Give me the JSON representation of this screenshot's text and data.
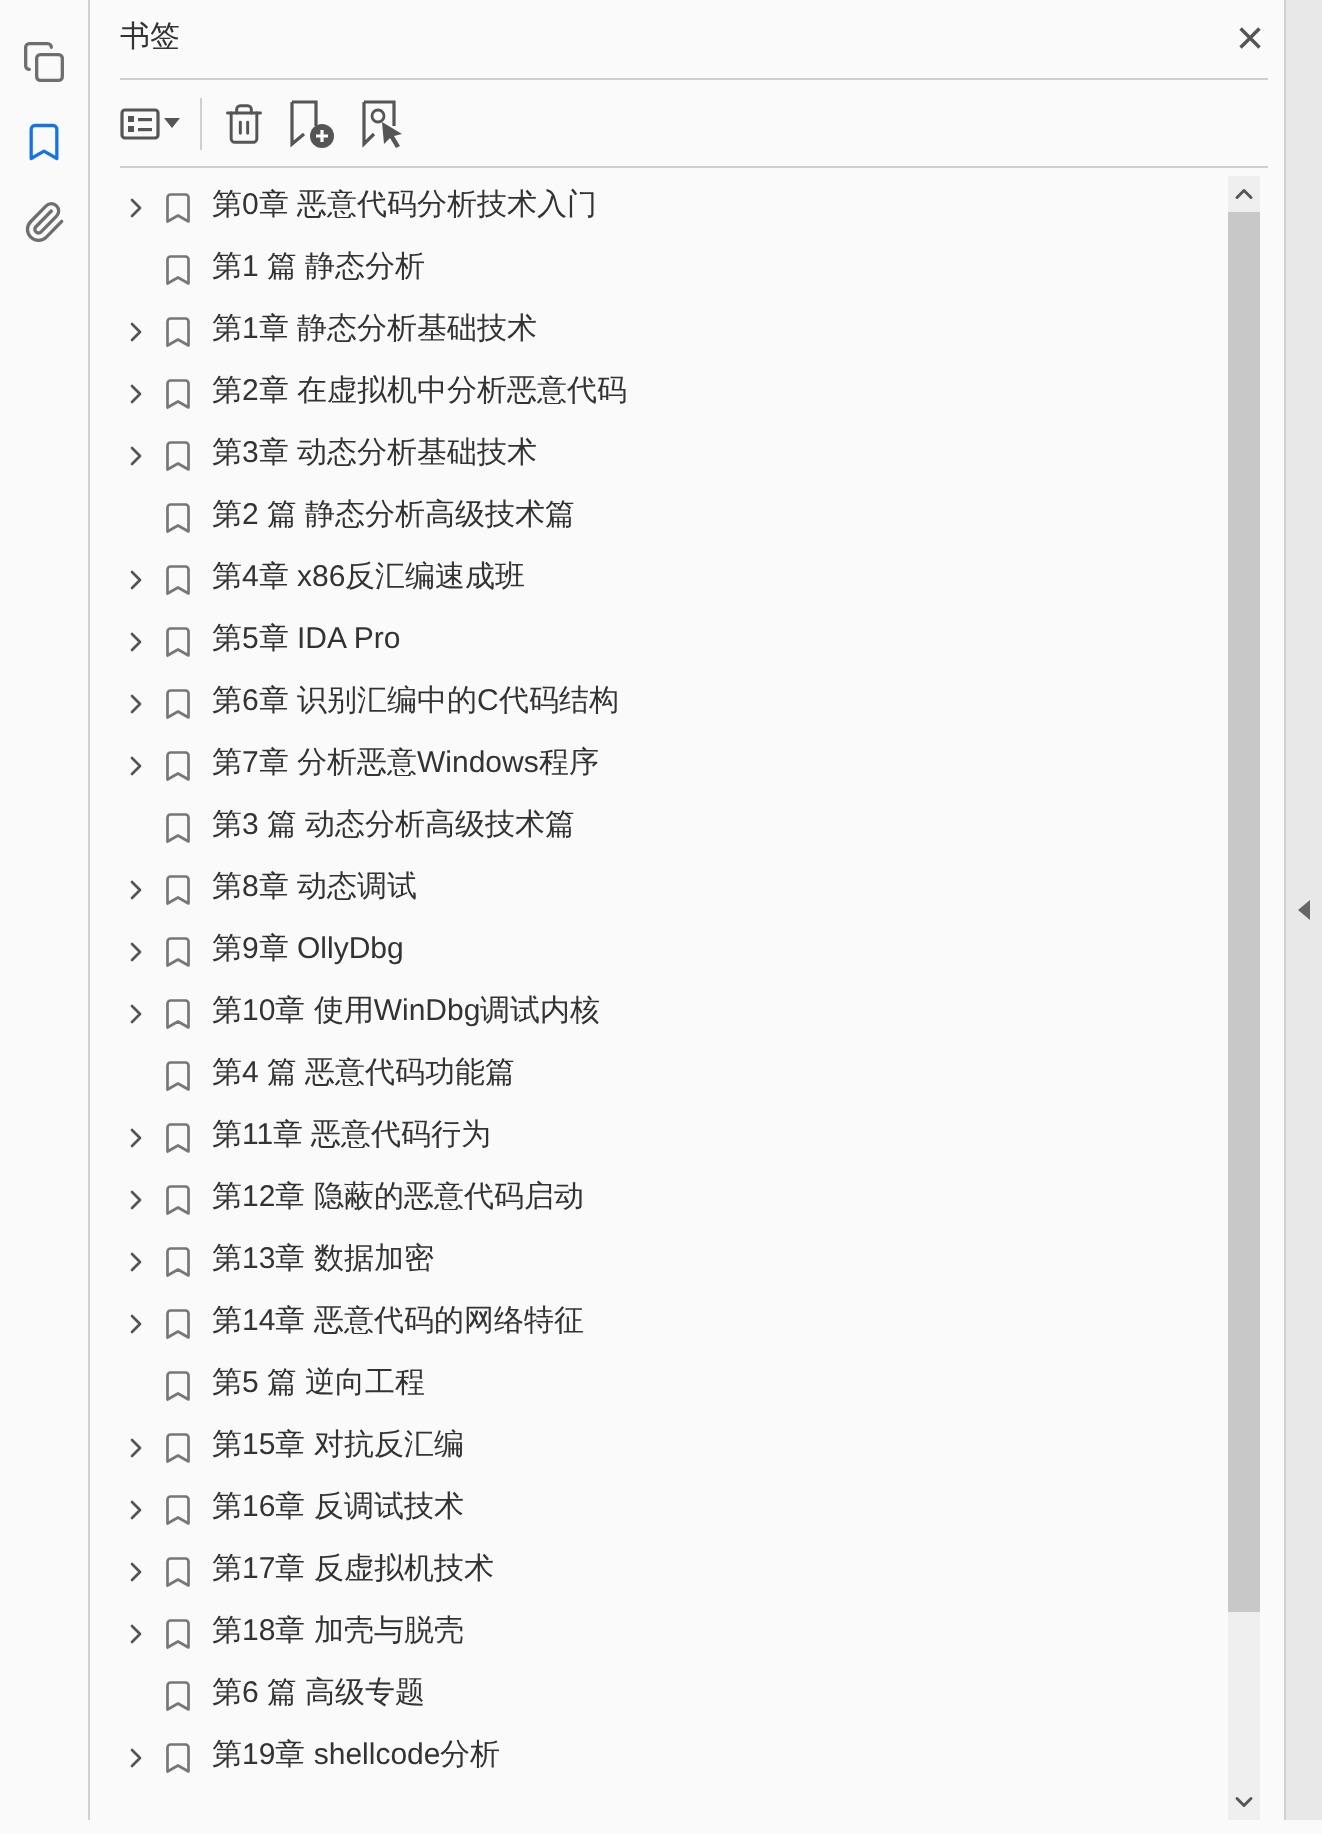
{
  "panel": {
    "title": "书签",
    "close": "×"
  },
  "rail": [
    {
      "kind": "pages",
      "selected": false
    },
    {
      "kind": "bookmarks",
      "selected": true
    },
    {
      "kind": "attachments",
      "selected": false
    }
  ],
  "bookmarks": [
    {
      "label": "第0章 恶意代码分析技术入门",
      "expandable": true
    },
    {
      "label": "第1 篇 静态分析",
      "expandable": false
    },
    {
      "label": "第1章 静态分析基础技术",
      "expandable": true
    },
    {
      "label": "第2章 在虚拟机中分析恶意代码",
      "expandable": true
    },
    {
      "label": "第3章 动态分析基础技术",
      "expandable": true
    },
    {
      "label": "第2 篇 静态分析高级技术篇",
      "expandable": false
    },
    {
      "label": "第4章 x86反汇编速成班",
      "expandable": true
    },
    {
      "label": "第5章 IDA Pro",
      "expandable": true
    },
    {
      "label": "第6章 识别汇编中的C代码结构",
      "expandable": true
    },
    {
      "label": "第7章 分析恶意Windows程序",
      "expandable": true
    },
    {
      "label": "第3 篇 动态分析高级技术篇",
      "expandable": false
    },
    {
      "label": "第8章 动态调试",
      "expandable": true
    },
    {
      "label": "第9章 OllyDbg",
      "expandable": true
    },
    {
      "label": "第10章 使用WinDbg调试内核",
      "expandable": true
    },
    {
      "label": "第4 篇 恶意代码功能篇",
      "expandable": false
    },
    {
      "label": "第11章 恶意代码行为",
      "expandable": true
    },
    {
      "label": "第12章 隐蔽的恶意代码启动",
      "expandable": true
    },
    {
      "label": "第13章 数据加密",
      "expandable": true
    },
    {
      "label": "第14章 恶意代码的网络特征",
      "expandable": true
    },
    {
      "label": "第5 篇 逆向工程",
      "expandable": false
    },
    {
      "label": "第15章 对抗反汇编",
      "expandable": true
    },
    {
      "label": "第16章 反调试技术",
      "expandable": true
    },
    {
      "label": "第17章 反虚拟机技术",
      "expandable": true
    },
    {
      "label": "第18章 加壳与脱壳",
      "expandable": true
    },
    {
      "label": "第6 篇 高级专题",
      "expandable": false
    },
    {
      "label": "第19章 shellcode分析",
      "expandable": true
    }
  ]
}
